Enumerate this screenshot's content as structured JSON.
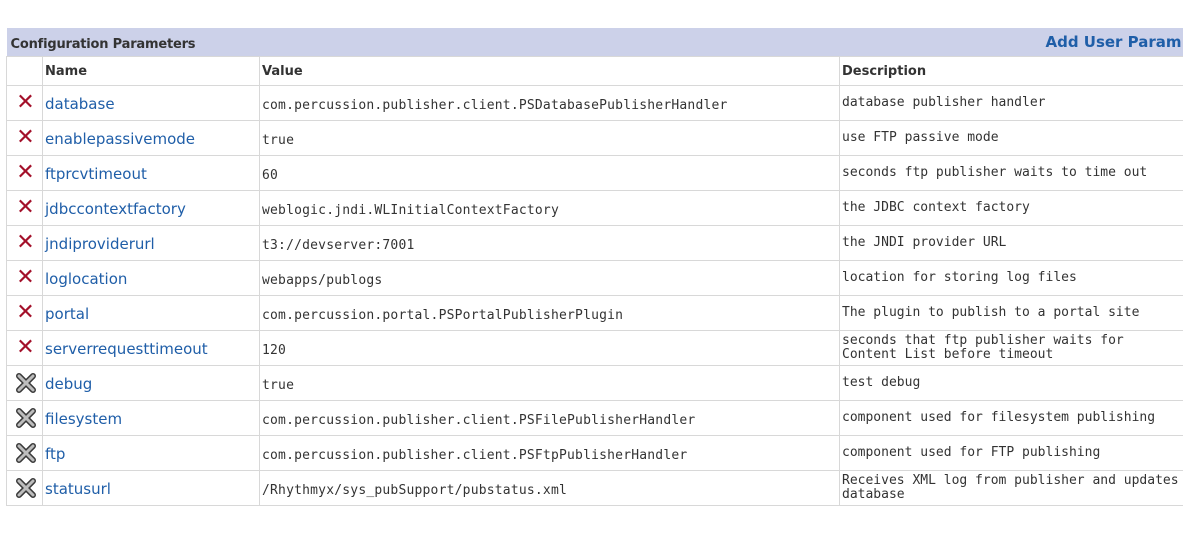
{
  "section": {
    "title": "Configuration Parameters",
    "add_link": "Add User Param"
  },
  "columns": {
    "name": "Name",
    "value": "Value",
    "description": "Description"
  },
  "rows": [
    {
      "icon": "red-x-delete-icon",
      "name": "database",
      "value": "com.percussion.publisher.client.PSDatabasePublisherHandler",
      "description": "database publisher handler"
    },
    {
      "icon": "red-x-delete-icon",
      "name": "enablepassivemode",
      "value": "true",
      "description": "use FTP passive mode"
    },
    {
      "icon": "red-x-delete-icon",
      "name": "ftprcvtimeout",
      "value": "60",
      "description": "seconds ftp publisher waits to time out"
    },
    {
      "icon": "red-x-delete-icon",
      "name": "jdbccontextfactory",
      "value": "weblogic.jndi.WLInitialContextFactory",
      "description": "the JDBC context factory"
    },
    {
      "icon": "red-x-delete-icon",
      "name": "jndiproviderurl",
      "value": "t3://devserver:7001",
      "description": "the JNDI provider URL"
    },
    {
      "icon": "red-x-delete-icon",
      "name": "loglocation",
      "value": "webapps/publogs",
      "description": "location for storing log files"
    },
    {
      "icon": "red-x-delete-icon",
      "name": "portal",
      "value": "com.percussion.portal.PSPortalPublisherPlugin",
      "description": "The plugin to publish to a portal site"
    },
    {
      "icon": "red-x-delete-icon",
      "name": "serverrequesttimeout",
      "value": "120",
      "description": "seconds that ftp publisher waits for Content List before timeout"
    },
    {
      "icon": "gray-x-delete-icon",
      "name": "debug",
      "value": "true",
      "description": "test debug"
    },
    {
      "icon": "gray-x-delete-icon",
      "name": "filesystem",
      "value": "com.percussion.publisher.client.PSFilePublisherHandler",
      "description": "component used for filesystem publishing"
    },
    {
      "icon": "gray-x-delete-icon",
      "name": "ftp",
      "value": "com.percussion.publisher.client.PSFtpPublisherHandler",
      "description": "component used for FTP publishing"
    },
    {
      "icon": "gray-x-delete-icon",
      "name": "statusurl",
      "value": "/Rhythmyx/sys_pubSupport/pubstatus.xml",
      "description": "Receives XML log from publisher and updates database"
    }
  ],
  "colors": {
    "header_band": "#ccd1e9",
    "link": "#1f5ea8",
    "delete_red": "#a3102a",
    "delete_gray": "#6e6e6e"
  }
}
